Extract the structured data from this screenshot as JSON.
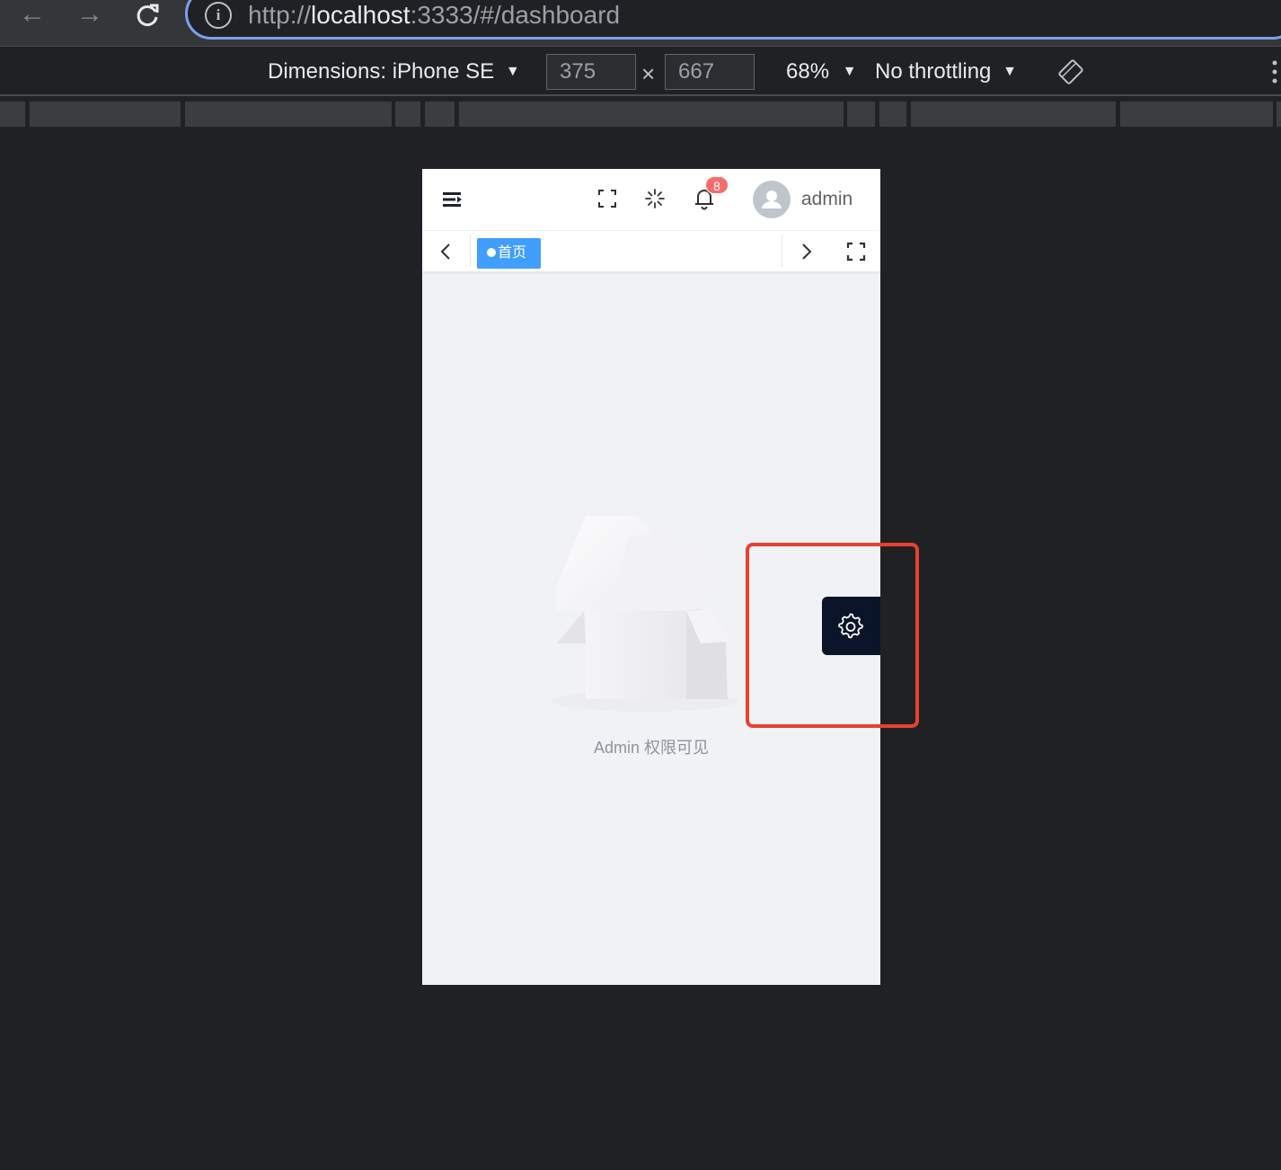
{
  "browser": {
    "url_scheme": "http://",
    "url_host": "localhost",
    "url_rest": ":3333/#/dashboard",
    "info_glyph": "i"
  },
  "devtools": {
    "dimensions_label": "Dimensions: iPhone SE",
    "width_value": "375",
    "height_value": "667",
    "times": "×",
    "zoom": "68%",
    "throttling": "No throttling",
    "dropdown_glyph": "▼"
  },
  "app": {
    "notification_count": "8",
    "username": "admin",
    "tabs": [
      {
        "label": "首页",
        "active": true
      }
    ],
    "empty_text": "Admin 权限可见"
  },
  "colors": {
    "accent": "#409eff",
    "badge": "#f56c6c",
    "settings_bg": "#0b1529",
    "highlight": "#e8412f"
  }
}
